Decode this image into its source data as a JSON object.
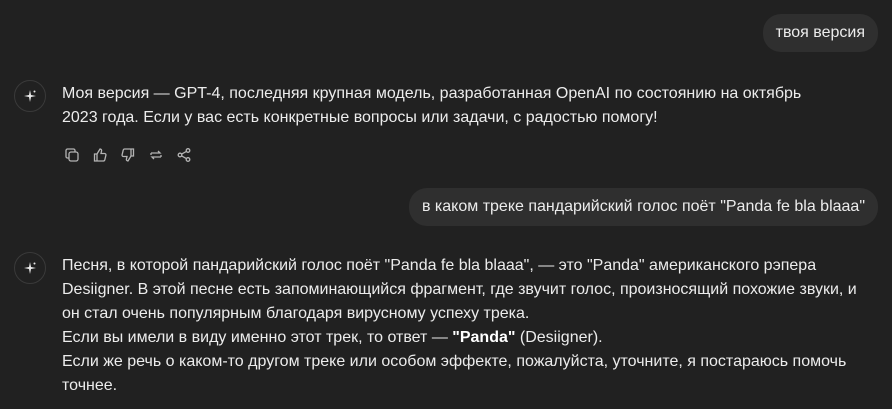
{
  "messages": {
    "user_1": "твоя версия",
    "assistant_1": {
      "line_1": "Моя версия — GPT-4, последняя крупная модель, разработанная OpenAI по состоянию на октябрь",
      "line_2": "2023 года. Если у вас есть конкретные вопросы или задачи, с радостью помогу!"
    },
    "user_2": "в каком треке пандарийский голос поёт \"Panda fe bla blaaa\"",
    "assistant_2": {
      "para_1": "Песня, в которой пандарийский голос поёт \"Panda fe bla blaaa\", — это \"Panda\" американского рэпера Desiigner. В этой песне есть запоминающийся фрагмент, где звучит голос, произносящий похожие звуки, и он стал очень популярным благодаря вирусному успеху трека.",
      "para_2_prefix": "Если вы имели в виду именно этот трек, то ответ — ",
      "para_2_bold": "\"Panda\"",
      "para_2_suffix": " (Desiigner).",
      "para_3": "Если же речь о каком-то другом треке или особом эффекте, пожалуйста, уточните, я постараюсь помочь точнее."
    }
  },
  "actions": [
    "copy-icon",
    "thumbs-up-icon",
    "thumbs-down-icon",
    "regenerate-icon",
    "share-icon"
  ],
  "colors": {
    "background": "#212121",
    "bubble": "#2f2f2f",
    "text": "#ececec",
    "icon": "#b4b4b4"
  }
}
